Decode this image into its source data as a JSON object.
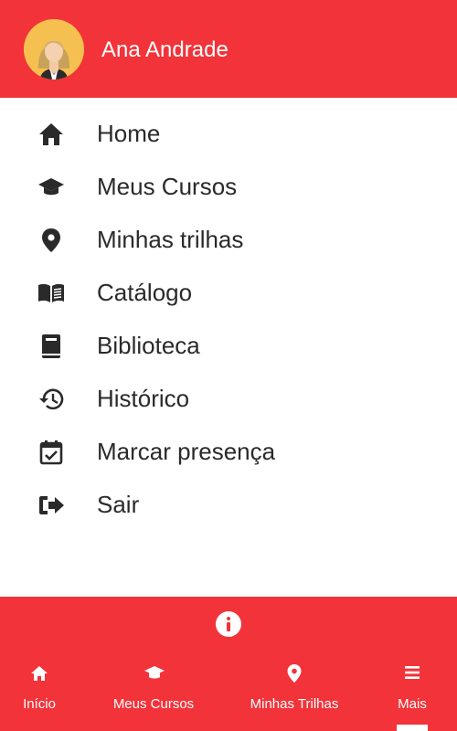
{
  "header": {
    "user_name": "Ana Andrade"
  },
  "colors": {
    "brand": "#f23339",
    "text": "#2a2a2a",
    "avatar_bg": "#f5c04f"
  },
  "menu": {
    "items": [
      {
        "label": "Home",
        "icon": "home-icon"
      },
      {
        "label": "Meus Cursos",
        "icon": "graduation-cap-icon"
      },
      {
        "label": "Minhas trilhas",
        "icon": "location-pin-icon"
      },
      {
        "label": "Catálogo",
        "icon": "open-book-icon"
      },
      {
        "label": "Biblioteca",
        "icon": "book-icon"
      },
      {
        "label": "Histórico",
        "icon": "history-icon"
      },
      {
        "label": "Marcar presença",
        "icon": "calendar-check-icon"
      },
      {
        "label": "Sair",
        "icon": "sign-out-icon"
      }
    ]
  },
  "bottom_nav": {
    "info_icon": "info-icon",
    "tabs": [
      {
        "label": "Início",
        "icon": "home-icon"
      },
      {
        "label": "Meus Cursos",
        "icon": "graduation-cap-icon"
      },
      {
        "label": "Minhas Trilhas",
        "icon": "location-pin-icon"
      },
      {
        "label": "Mais",
        "icon": "hamburger-menu-icon",
        "active": true
      }
    ]
  }
}
